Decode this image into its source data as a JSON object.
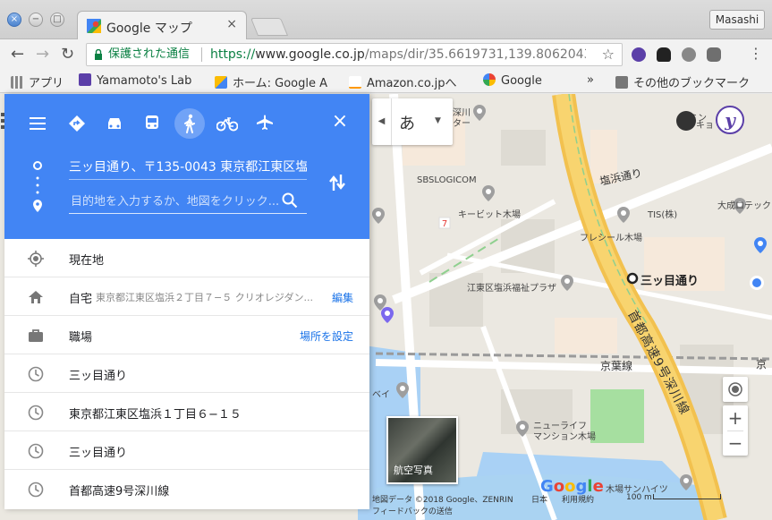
{
  "browser": {
    "tab_title": "Google マップ",
    "tab_close": "×",
    "user_name": "Masashi",
    "secure_label": "保護された通信",
    "url_scheme": "https://",
    "url_host": "www.google.co.jp",
    "url_path": "/maps/dir/35.6619731,139.8062043//@...",
    "bookmarks": [
      "アプリ",
      "Yamamoto's Lab",
      "ホーム: Google A",
      "Amazon.co.jpへ",
      "Google"
    ],
    "bookmarks_more": "»",
    "other_bookmarks": "その他のブックマーク"
  },
  "panel": {
    "close": "×",
    "origin": "三ッ目通り、〒135-0043 東京都江東区塩",
    "destination_placeholder": "目的地を入力するか、地図をクリック...",
    "rows": [
      {
        "label": "現在地",
        "sub": "",
        "action": ""
      },
      {
        "label": "自宅",
        "sub": "東京都江東区塩浜２丁目７−５ クリオレジダン...",
        "action": "編集"
      },
      {
        "label": "職場",
        "sub": "",
        "action": "場所を設定"
      },
      {
        "label": "三ッ目通り",
        "sub": "",
        "action": ""
      },
      {
        "label": "東京都江東区塩浜１丁目６−１５",
        "sub": "",
        "action": ""
      },
      {
        "label": "三ッ目通り",
        "sub": "",
        "action": ""
      },
      {
        "label": "首都高速9号深川線",
        "sub": "",
        "action": ""
      }
    ]
  },
  "map": {
    "ime_char": "あ",
    "labels": {
      "fukagawa": "深川",
      "ta": "ター",
      "shiohama": "塩浜通り",
      "sbs": "SBSLOGICOM",
      "kibit": "キービット木場",
      "tis": "TIS(株)",
      "taisei": "大成ロテック",
      "freshiel": "フレシール木場",
      "welfare": "江東区塩浜福祉プラザ",
      "mitsume": "三ッ目通り",
      "highway": "首都高速9号深川線",
      "keiyo": "京葉線",
      "keiyo2": "京",
      "bay": "ベイ",
      "newlife": "ニューライフ",
      "newlife2": "マンション木場",
      "sunheights": "木場サンハイツ",
      "kyo": "キョ",
      "tokyo": "トミン"
    },
    "aerial": "航空写真",
    "zoom_in": "+",
    "zoom_out": "−",
    "footer": {
      "data": "地図データ ©2018 Google、ZENRIN",
      "japan": "日本",
      "terms": "利用規約",
      "scale": "100 m",
      "feedback": "フィードバックの送信"
    },
    "logo": "Google"
  }
}
